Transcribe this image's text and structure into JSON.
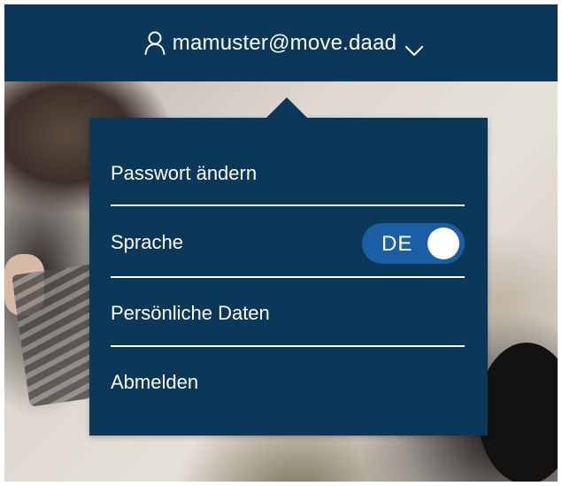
{
  "header": {
    "user_email": "mamuster@move.daad",
    "user_icon": "user-icon",
    "dropdown_icon": "chevron-down-icon"
  },
  "menu": {
    "items": [
      {
        "label": "Passwort ändern"
      },
      {
        "label": "Sprache"
      },
      {
        "label": "Persönliche Daten"
      },
      {
        "label": "Abmelden"
      }
    ],
    "language_toggle": {
      "value": "DE",
      "state": "on"
    }
  },
  "colors": {
    "brand_navy": "#0b3758",
    "toggle_blue": "#1a5fa6",
    "text": "#ffffff"
  }
}
